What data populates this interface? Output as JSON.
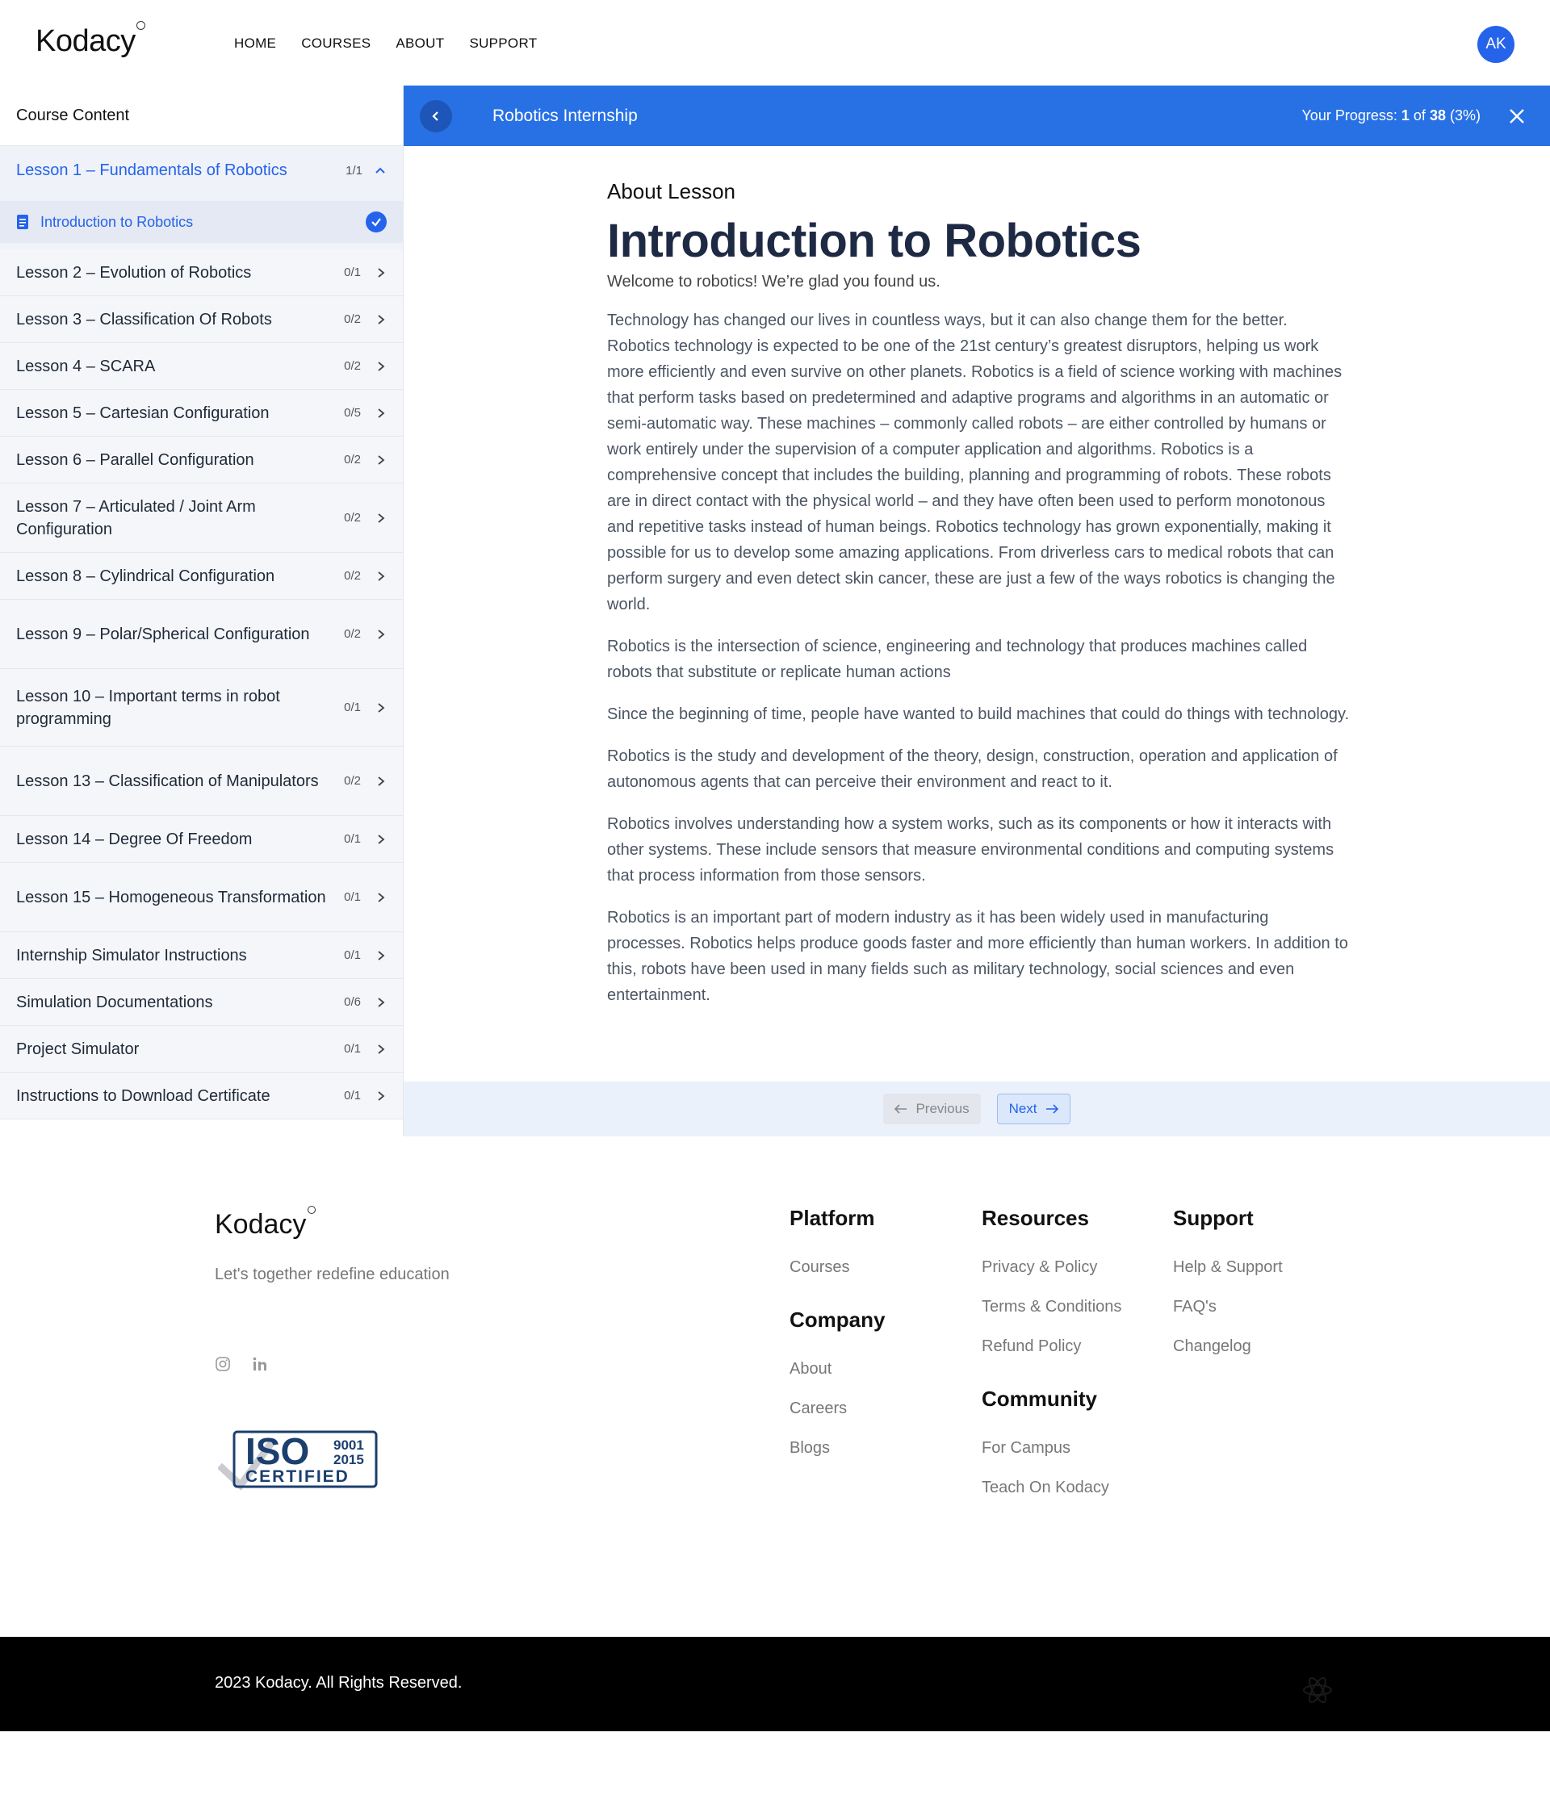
{
  "header": {
    "logo": "Kodacy",
    "nav": [
      "HOME",
      "COURSES",
      "ABOUT",
      "SUPPORT"
    ],
    "avatar_initials": "AK"
  },
  "sidebar": {
    "title": "Course Content",
    "active_lesson": {
      "name": "Lesson 1 – Fundamentals of Robotics",
      "count": "1/1"
    },
    "active_sub_item": "Introduction to Robotics",
    "lessons": [
      {
        "name": "Lesson 2 – Evolution of Robotics",
        "count": "0/1"
      },
      {
        "name": "Lesson 3 – Classification Of Robots",
        "count": "0/2"
      },
      {
        "name": "Lesson 4 – SCARA",
        "count": "0/2"
      },
      {
        "name": "Lesson 5 – Cartesian Configuration",
        "count": "0/5"
      },
      {
        "name": "Lesson 6 – Parallel Configuration",
        "count": "0/2"
      },
      {
        "name": "Lesson 7 – Articulated / Joint Arm Configuration",
        "count": "0/2"
      },
      {
        "name": "Lesson 8 – Cylindrical Configuration",
        "count": "0/2"
      },
      {
        "name": "Lesson 9 – Polar/Spherical Configuration",
        "count": "0/2"
      },
      {
        "name": "Lesson 10 – Important terms in robot programming",
        "count": "0/1"
      },
      {
        "name": "Lesson 13 – Classification of Manipulators",
        "count": "0/2"
      },
      {
        "name": "Lesson 14 – Degree Of Freedom",
        "count": "0/1"
      },
      {
        "name": "Lesson 15 – Homogeneous Transformation",
        "count": "0/1"
      },
      {
        "name": "Internship Simulator Instructions",
        "count": "0/1"
      },
      {
        "name": "Simulation Documentations",
        "count": "0/6"
      },
      {
        "name": "Project Simulator",
        "count": "0/1"
      },
      {
        "name": "Instructions to Download Certificate",
        "count": "0/1"
      }
    ]
  },
  "lessonbar": {
    "course_title": "Robotics Internship",
    "progress_label": "Your Progress:",
    "progress_current": "1",
    "progress_of": "of",
    "progress_total": "38",
    "progress_percent": "(3%)"
  },
  "content": {
    "section_label": "About Lesson",
    "title": "Introduction to Robotics",
    "welcome": "Welcome to robotics! We’re glad you found us.",
    "paragraphs": [
      "Technology has changed our lives in countless ways, but it can also change them for the better. Robotics technology is expected to be one of the 21st century’s greatest disruptors, helping us work more efficiently and even survive on other planets. Robotics is a field of science working with machines that perform tasks based on predetermined and adaptive programs and algorithms in an automatic or semi-automatic way. These machines – commonly called robots – are either controlled by humans or work entirely under the supervision of a computer application and algorithms. Robotics is a comprehensive concept that includes the building, planning and programming of robots. These robots are in direct contact with the physical world – and they have often been used to perform monotonous and repetitive tasks instead of human beings. Robotics technology has grown exponentially, making it possible for us to develop some amazing applications. From driverless cars to medical robots that can perform surgery and even detect skin cancer, these are just a few of the ways robotics is changing the world.",
      "Robotics is the intersection of science, engineering and technology that produces machines called robots that substitute or replicate human actions",
      "Since the beginning of time, people have wanted to build machines that could do things with technology.",
      "Robotics is the study and development of the theory, design, construction, operation and application of autonomous agents that can perceive their environment and react to it.",
      "Robotics involves understanding how a system works, such as its components or how it interacts with other systems. These include sensors that measure environmental conditions and computing systems that process information from those sensors.",
      "Robotics is an important part of modern industry as it has been widely used in manufacturing processes. Robotics helps produce goods faster and more efficiently than human workers. In addition to this, robots have been used in many fields such as military technology, social sciences and even entertainment."
    ]
  },
  "pager": {
    "previous": "Previous",
    "next": "Next"
  },
  "footer": {
    "logo": "Kodacy",
    "tagline": "Let's together redefine education",
    "iso": {
      "big": "ISO",
      "num1": "9001",
      "num2": "2015",
      "certified": "CERTIFIED"
    },
    "platform": {
      "heading": "Platform",
      "links": [
        "Courses"
      ]
    },
    "company": {
      "heading": "Company",
      "links": [
        "About",
        "Careers",
        "Blogs"
      ]
    },
    "resources": {
      "heading": "Resources",
      "links": [
        "Privacy & Policy",
        "Terms & Conditions",
        "Refund Policy"
      ]
    },
    "community": {
      "heading": "Community",
      "links": [
        "For Campus",
        "Teach On Kodacy"
      ]
    },
    "support": {
      "heading": "Support",
      "links": [
        "Help & Support",
        "FAQ's",
        "Changelog"
      ]
    },
    "copyright": "2023 Kodacy. All Rights Reserved."
  },
  "colors": {
    "accent": "#2771e5",
    "dark_title": "#1e2a44",
    "footer_bar": "#000000"
  },
  "icons": [
    "chevron-up-icon",
    "chevron-right-icon",
    "document-icon",
    "check-circle-icon",
    "chevron-left-icon",
    "close-icon",
    "arrow-left-icon",
    "arrow-right-icon",
    "instagram-icon",
    "linkedin-icon"
  ]
}
